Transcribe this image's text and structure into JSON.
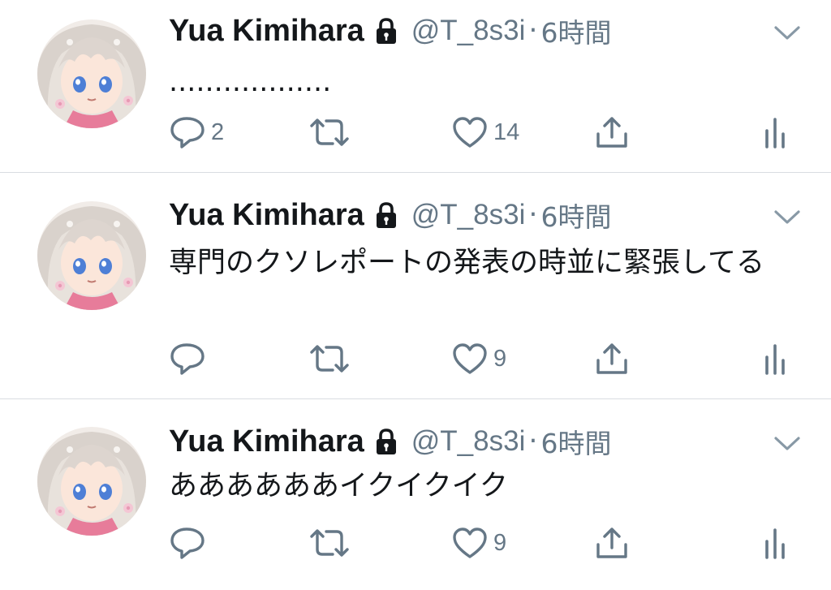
{
  "colors": {
    "text": "#14171a",
    "secondary": "#657786",
    "divider": "#d9dde1"
  },
  "tweets": [
    {
      "name": "Yua Kimihara",
      "protected_icon": "lock-icon",
      "handle": "@T_8s3i",
      "separator": "·",
      "time": "6時間",
      "text": "..................",
      "reply_count": "2",
      "retweet_count": "",
      "like_count": "14"
    },
    {
      "name": "Yua Kimihara",
      "protected_icon": "lock-icon",
      "handle": "@T_8s3i",
      "separator": "·",
      "time": "6時間",
      "text": "専門のクソレポートの発表の時並に緊張してる",
      "reply_count": "",
      "retweet_count": "",
      "like_count": "9"
    },
    {
      "name": "Yua Kimihara",
      "protected_icon": "lock-icon",
      "handle": "@T_8s3i",
      "separator": "·",
      "time": "6時間",
      "text": "ああああああイクイクイク",
      "reply_count": "",
      "retweet_count": "",
      "like_count": "9"
    }
  ],
  "icons": [
    "avatar",
    "lock-icon",
    "chevron-down-icon",
    "reply-icon",
    "retweet-icon",
    "like-icon",
    "share-icon",
    "analytics-icon"
  ]
}
